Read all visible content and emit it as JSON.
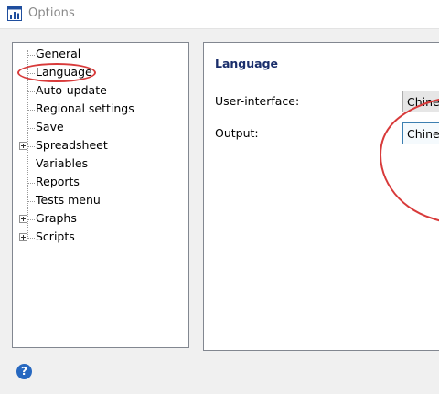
{
  "window": {
    "title": "Options",
    "app_icon": "chart-app-icon"
  },
  "tree": {
    "items": [
      {
        "label": "General",
        "expandable": false
      },
      {
        "label": "Language",
        "expandable": false,
        "selected": true
      },
      {
        "label": "Auto-update",
        "expandable": false
      },
      {
        "label": "Regional settings",
        "expandable": false
      },
      {
        "label": "Save",
        "expandable": false
      },
      {
        "label": "Spreadsheet",
        "expandable": true
      },
      {
        "label": "Variables",
        "expandable": false
      },
      {
        "label": "Reports",
        "expandable": false
      },
      {
        "label": "Tests menu",
        "expandable": false
      },
      {
        "label": "Graphs",
        "expandable": true
      },
      {
        "label": "Scripts",
        "expandable": true
      }
    ]
  },
  "content": {
    "section_title": "Language",
    "user_interface_label": "User-interface:",
    "user_interface_value": "Chinese",
    "output_label": "Output:",
    "output_value": "Chinese"
  },
  "footer": {
    "help_symbol": "?",
    "help_icon": "help-icon"
  },
  "colors": {
    "annotation": "#d83a3a",
    "section_title": "#1a2e6b",
    "help": "#2768c0"
  }
}
